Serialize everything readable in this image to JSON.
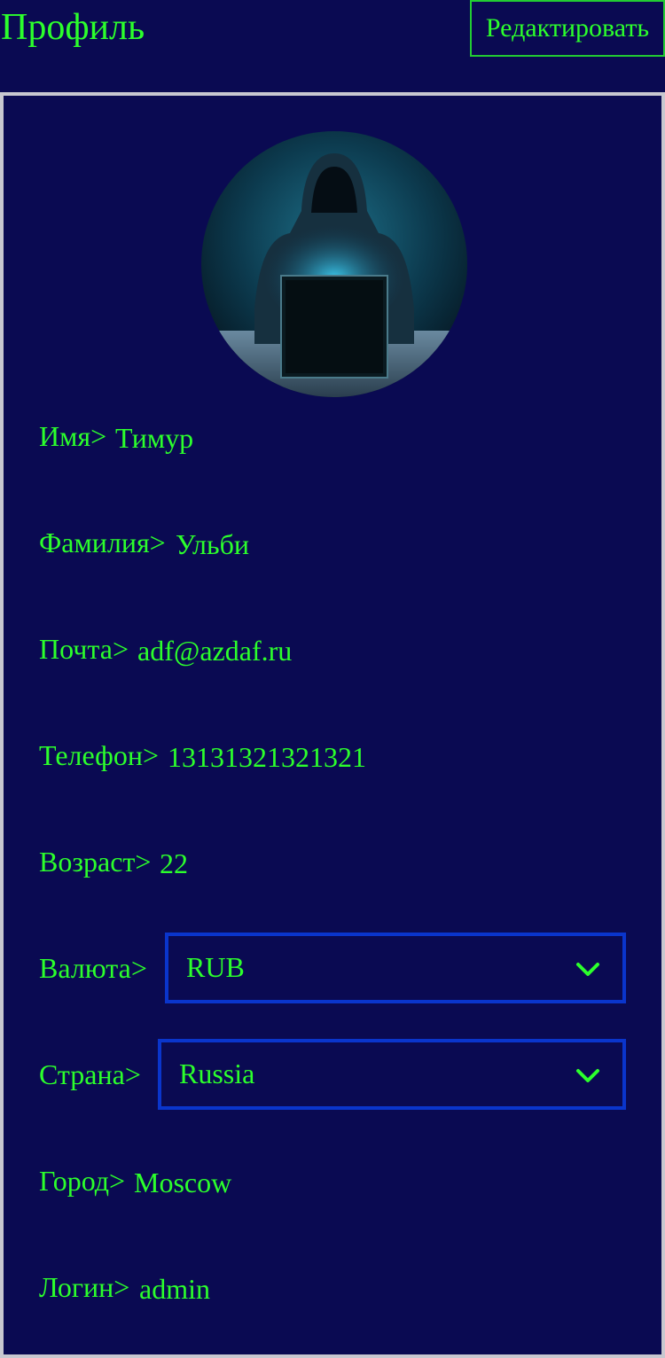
{
  "header": {
    "title": "Профиль",
    "edit_label": "Редактировать"
  },
  "profile": {
    "avatar_icon": "hooded-hacker-avatar",
    "fields": {
      "name": {
        "label": "Имя>",
        "value": "Тимур"
      },
      "surname": {
        "label": "Фамилия>",
        "value": "Ульби"
      },
      "email": {
        "label": "Почта>",
        "value": "adf@azdaf.ru"
      },
      "phone": {
        "label": "Телефон>",
        "value": "13131321321321"
      },
      "age": {
        "label": "Возраст>",
        "value": "22"
      },
      "currency": {
        "label": "Валюта>",
        "selected": "RUB"
      },
      "country": {
        "label": "Страна>",
        "selected": "Russia"
      },
      "city": {
        "label": "Город>",
        "value": "Moscow"
      },
      "login": {
        "label": "Логин>",
        "value": "admin"
      }
    }
  },
  "colors": {
    "background": "#0a0a52",
    "text": "#2cff2c",
    "select_border": "#0a35cc",
    "card_border": "#c8c8d0"
  }
}
